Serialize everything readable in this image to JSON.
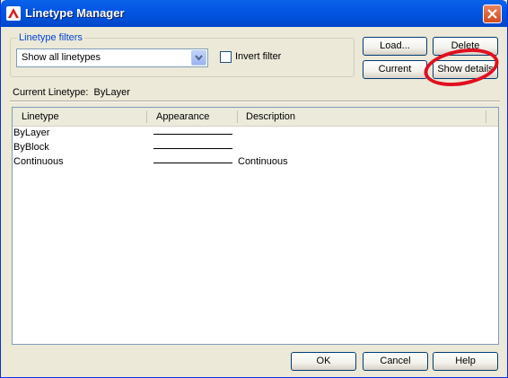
{
  "window": {
    "title": "Linetype Manager"
  },
  "filters": {
    "group_label": "Linetype filters",
    "selected": "Show all linetypes",
    "invert_label": "Invert filter",
    "invert_checked": false
  },
  "buttons": {
    "load": "Load...",
    "delete": "Delete",
    "current": "Current",
    "show_details": "Show details",
    "ok": "OK",
    "cancel": "Cancel",
    "help": "Help"
  },
  "current_linetype": {
    "label": "Current Linetype:",
    "value": "ByLayer"
  },
  "table": {
    "columns": [
      "Linetype",
      "Appearance",
      "Description"
    ],
    "rows": [
      {
        "name": "ByLayer",
        "description": ""
      },
      {
        "name": "ByBlock",
        "description": ""
      },
      {
        "name": "Continuous",
        "description": "Continuous"
      }
    ]
  },
  "colors": {
    "titlebar": "#0254e3",
    "highlight": "#e01020",
    "accent": "#0046d5"
  }
}
